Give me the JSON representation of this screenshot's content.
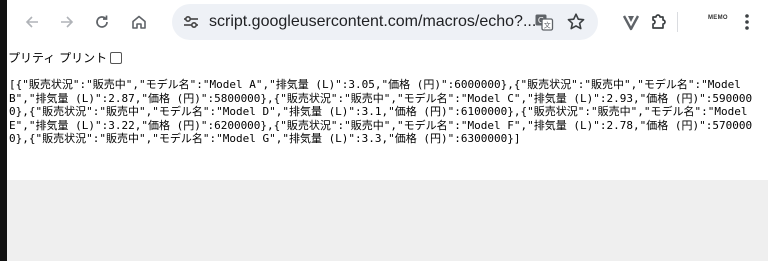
{
  "browser": {
    "url": "script.googleusercontent.com/macros/echo?...",
    "extension_badge": "MEMO",
    "icons": {
      "back": "arrow-left-icon",
      "forward": "arrow-right-icon",
      "reload": "reload-icon",
      "home": "home-icon",
      "site_info": "tune-icon",
      "translate": "translate-icon",
      "bookmark": "star-icon",
      "extension": "vivaldi-v-icon",
      "puzzle": "puzzle-icon",
      "menu": "kebab-menu-icon"
    }
  },
  "page": {
    "pretty_print_label": "プリティ プリント",
    "pretty_print_checked": false,
    "json_text": "[{\"販売状況\":\"販売中\",\"モデル名\":\"Model A\",\"排気量 (L)\":3.05,\"価格 (円)\":6000000},{\"販売状況\":\"販売中\",\"モデル名\":\"Model B\",\"排気量 (L)\":2.87,\"価格 (円)\":5800000},{\"販売状況\":\"販売中\",\"モデル名\":\"Model C\",\"排気量 (L)\":2.93,\"価格 (円)\":5900000},{\"販売状況\":\"販売中\",\"モデル名\":\"Model D\",\"排気量 (L)\":3.1,\"価格 (円)\":6100000},{\"販売状況\":\"販売中\",\"モデル名\":\"Model E\",\"排気量 (L)\":3.22,\"価格 (円)\":6200000},{\"販売状況\":\"販売中\",\"モデル名\":\"Model F\",\"排気量 (L)\":2.78,\"価格 (円)\":5700000},{\"販売状況\":\"販売中\",\"モデル名\":\"Model G\",\"排気量 (L)\":3.3,\"価格 (円)\":6300000}]"
  },
  "colors": {
    "toolbar_bg": "#ffffff",
    "omnibox_bg": "#eef1f6",
    "icon": "#5f6368",
    "page_bg": "#ffffff",
    "below_bg": "#efefef"
  }
}
